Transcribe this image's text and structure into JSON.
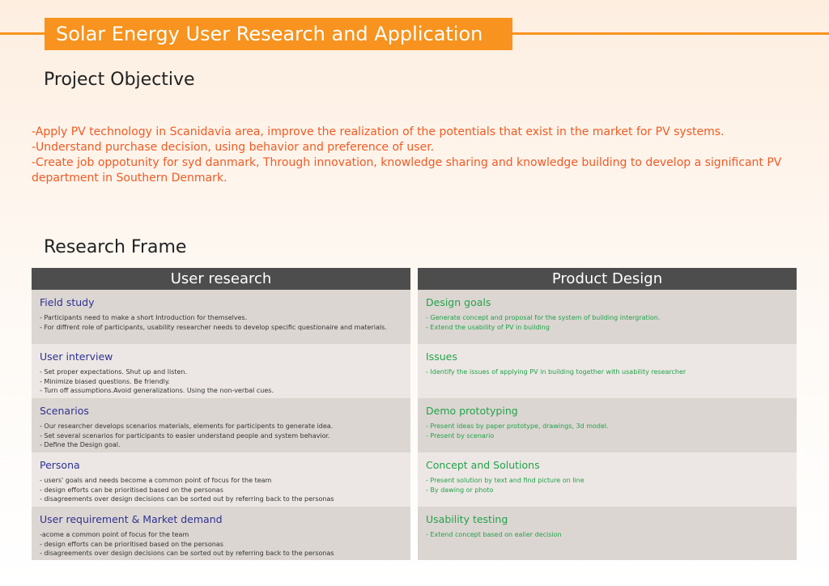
{
  "title": "Solar Energy User Research and Application",
  "project_objective": {
    "heading": "Project Objective",
    "lines": [
      "-Apply PV technology in Scanidavia area, improve the realization of the potentials that exist in the market for PV systems.",
      "-Understand purchase decision, using behavior and preference of user.",
      "-Create job oppotunity for syd danmark, Through innovation, knowledge sharing and knowledge building to develop a significant PV department in Southern Denmark."
    ]
  },
  "research_frame": {
    "heading": "Research Frame",
    "user_research": {
      "header": "User research",
      "rows": [
        {
          "title": "Field study",
          "lines": [
            "- Participants need to make a short Introduction for themselves.",
            "- For diffrent role of participants, usability researcher needs to develop specific questionaire and materials."
          ]
        },
        {
          "title": "User interview",
          "lines": [
            "- Set proper expectations. Shut up and listen.",
            "- Minimize biased questions. Be friendly.",
            "- Turn off assumptions.Avoid generalizations. Using the non-verbal cues."
          ]
        },
        {
          "title": "Scenarios",
          "lines": [
            "- Our researcher develops scenarios materials, elements for participents to generate idea.",
            "- Set several scenarios for participants to easier understand people and system behavior.",
            "- Define the Design goal."
          ]
        },
        {
          "title": "Persona",
          "lines": [
            "- users' goals and needs become a common point of focus for the team",
            "- design efforts can be prioritised based on the personas",
            "- disagreements over design decisions can be sorted out by referring back to the personas"
          ]
        },
        {
          "title": "User requirement & Market demand",
          "lines": [
            "-acome a common point of focus for the team",
            "- design efforts can be prioritised based on the personas",
            "- disagreements over design decisions can be sorted out by referring back to the personas"
          ]
        }
      ]
    },
    "product_design": {
      "header": "Product Design",
      "rows": [
        {
          "title": "Design goals",
          "lines": [
            "- Generate concept and proposal for the system of building intergration.",
            "- Extend the usability of PV in building"
          ]
        },
        {
          "title": "Issues",
          "lines": [
            "- Identify the issues of applying PV in building together with usability researcher"
          ]
        },
        {
          "title": "Demo prototyping",
          "lines": [
            "- Present ideas by paper prototype, drawings, 3d model.",
            "- Present by scenario"
          ]
        },
        {
          "title": "Concept and Solutions",
          "lines": [
            "- Present solution by text and find picture on line",
            "- By dawing or photo"
          ]
        },
        {
          "title": "Usability testing",
          "lines": [
            "- Extend concept based on ealier decision"
          ]
        }
      ]
    }
  },
  "colors": {
    "accent_orange": "#f7931e",
    "objective_text": "#f15a24",
    "user_title": "#2e3192",
    "design_title": "#22a24a",
    "header_bg": "#4d4d4d",
    "row_dark": "#dcd6d2",
    "row_light": "#ece7e4"
  }
}
